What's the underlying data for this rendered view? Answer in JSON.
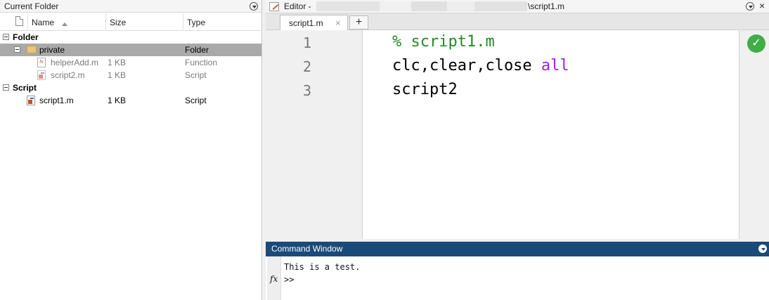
{
  "current_folder": {
    "title": "Current Folder",
    "columns": {
      "name": "Name",
      "size": "Size",
      "type": "Type"
    },
    "groups": {
      "folder": {
        "label": "Folder",
        "row": {
          "name": "private",
          "size": "",
          "type": "Folder"
        },
        "children": [
          {
            "name": "helperAdd.m",
            "size": "1 KB",
            "type": "Function"
          },
          {
            "name": "script2.m",
            "size": "1 KB",
            "type": "Script"
          }
        ]
      },
      "script": {
        "label": "Script",
        "row": {
          "name": "script1.m",
          "size": "1 KB",
          "type": "Script"
        }
      }
    }
  },
  "editor": {
    "title_prefix": "Editor -",
    "title_suffix": "\\script1.m",
    "tab_label": "script1.m",
    "tab_close": "×",
    "add_tab": "+",
    "lines": [
      {
        "number": "1",
        "comment": "% script1.m",
        "text": "",
        "keyword": ""
      },
      {
        "number": "2",
        "comment": "",
        "text": "clc,clear,close ",
        "keyword": "all"
      },
      {
        "number": "3",
        "comment": "",
        "text": "script2",
        "keyword": ""
      }
    ],
    "status_icon": "check-icon",
    "close_glyph": "×"
  },
  "command_window": {
    "title": "Command Window",
    "output": "This is a test.",
    "prompt": ">>",
    "fx_label": "fx"
  },
  "colors": {
    "comment": "#228b22",
    "keyword": "#a020f0",
    "command_title_bg": "#1a4a7a",
    "status_ok": "#3fae49"
  }
}
